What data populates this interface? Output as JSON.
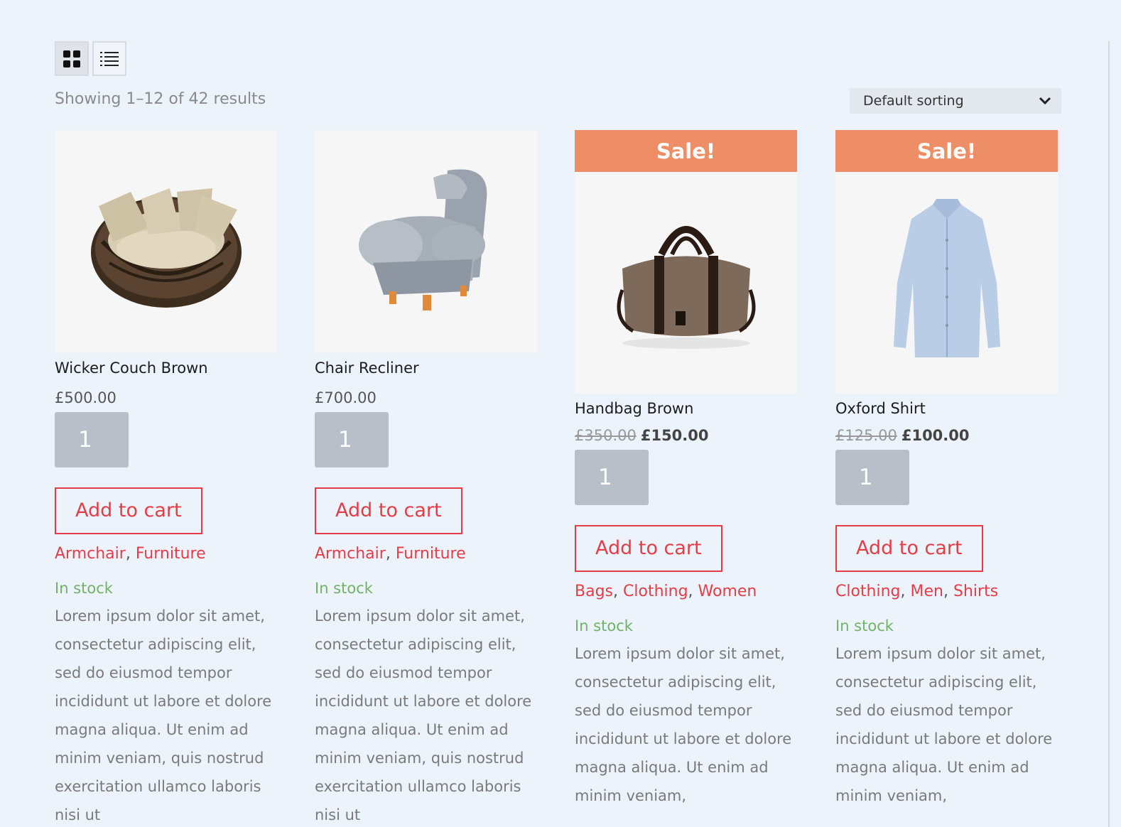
{
  "toolbar": {
    "grid_view_icon": "grid-icon",
    "list_view_icon": "list-icon",
    "results_text": "Showing 1–12 of 42 results",
    "sort_selected": "Default sorting"
  },
  "colors": {
    "background": "#ecf3fb",
    "accent": "#e43d48",
    "sale_badge": "#ee8e66",
    "in_stock": "#72b16a",
    "qty_box": "#b8bfc8"
  },
  "products": [
    {
      "title": "Wicker Couch Brown",
      "price": "£500.00",
      "qty": "1",
      "add_label": "Add to cart",
      "cat1": "Armchair",
      "sep1": ", ",
      "cat2": "Furniture",
      "stock": "In stock",
      "description": "Lorem ipsum dolor sit amet, consectetur adipiscing elit, sed do eiusmod tempor incididunt ut labore et dolore magna aliqua. Ut enim ad minim veniam, quis nostrud exercitation ullamco laboris nisi ut"
    },
    {
      "title": "Chair Recliner",
      "price": "£700.00",
      "qty": "1",
      "add_label": "Add to cart",
      "cat1": "Armchair",
      "sep1": ", ",
      "cat2": "Furniture",
      "stock": "In stock",
      "description": "Lorem ipsum dolor sit amet, consectetur adipiscing elit, sed do eiusmod tempor incididunt ut labore et dolore magna aliqua. Ut enim ad minim veniam, quis nostrud exercitation ullamco laboris nisi ut"
    },
    {
      "sale_label": "Sale!",
      "title": "Handbag Brown",
      "old_price": "£350.00",
      "new_price": "£150.00",
      "qty": "1",
      "add_label": "Add to cart",
      "cat1": "Bags",
      "sep1": ", ",
      "cat2": "Clothing",
      "sep2": ", ",
      "cat3": "Women",
      "stock": "In stock",
      "description": "Lorem ipsum dolor sit amet, consectetur adipiscing elit, sed do eiusmod tempor incididunt ut labore et dolore magna aliqua. Ut enim ad minim veniam,"
    },
    {
      "sale_label": "Sale!",
      "title": "Oxford Shirt",
      "old_price": "£125.00",
      "new_price": "£100.00",
      "qty": "1",
      "add_label": "Add to cart",
      "cat1": "Clothing",
      "sep1": ", ",
      "cat2": "Men",
      "sep2": ", ",
      "cat3": "Shirts",
      "stock": "In stock",
      "description": "Lorem ipsum dolor sit amet, consectetur adipiscing elit, sed do eiusmod tempor incididunt ut labore et dolore magna aliqua. Ut enim ad minim veniam,"
    }
  ]
}
